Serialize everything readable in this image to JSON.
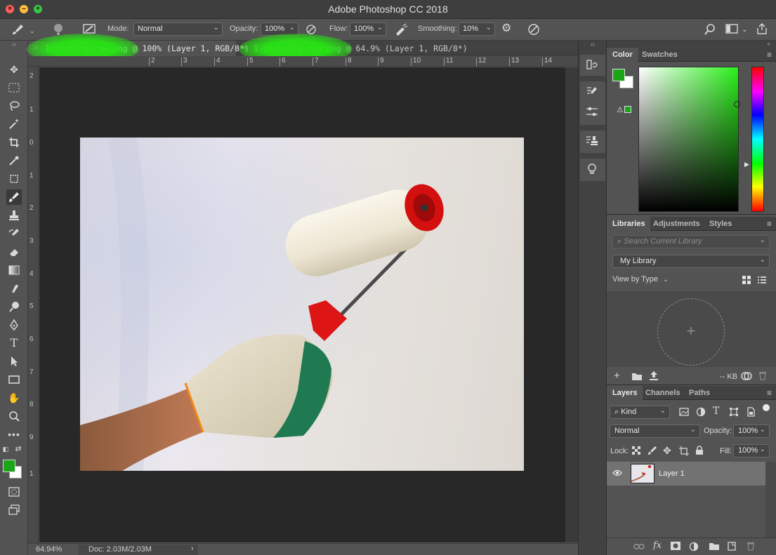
{
  "window": {
    "title": "Adobe Photoshop CC 2018"
  },
  "options_bar": {
    "mode_label": "Mode:",
    "mode_value": "Normal",
    "opacity_label": "Opacity:",
    "opacity_value": "100%",
    "flow_label": "Flow:",
    "flow_value": "100%",
    "smoothing_label": "Smoothing:",
    "smoothing_value": "10%"
  },
  "tabs": [
    {
      "label": "1-coating-raw.png @ 100% (Layer 1, RGB/8*)"
    },
    {
      "label": "1-painting-raw.png @ 64.9% (Layer 1, RGB/8*)"
    }
  ],
  "ruler_top": [
    "2",
    "3",
    "4",
    "5",
    "6",
    "7",
    "8",
    "9",
    "10",
    "11",
    "12",
    "13",
    "14"
  ],
  "ruler_left": [
    "2",
    "1",
    "0",
    "1",
    "2",
    "3",
    "4",
    "5",
    "6",
    "7",
    "8",
    "9",
    "1"
  ],
  "status": {
    "zoom": "64.94%",
    "doc": "Doc: 2.03M/2.03M",
    "arrow": "›"
  },
  "colors": {
    "foreground": "#1da51a",
    "background": "#ffffff",
    "highlight": "#28e614"
  },
  "color_panel": {
    "tabs": [
      "Color",
      "Swatches"
    ]
  },
  "libraries_panel": {
    "tabs": [
      "Libraries",
      "Adjustments",
      "Styles"
    ],
    "search_placeholder": "Search Current Library",
    "library": "My Library",
    "view_by": "View by Type",
    "size": "-- KB"
  },
  "layers_panel": {
    "tabs": [
      "Layers",
      "Channels",
      "Paths"
    ],
    "kind": "Kind",
    "blend": "Normal",
    "opacity_label": "Opacity:",
    "opacity_value": "100%",
    "lock_label": "Lock:",
    "fill_label": "Fill:",
    "fill_value": "100%",
    "layers": [
      {
        "name": "Layer 1"
      }
    ]
  }
}
